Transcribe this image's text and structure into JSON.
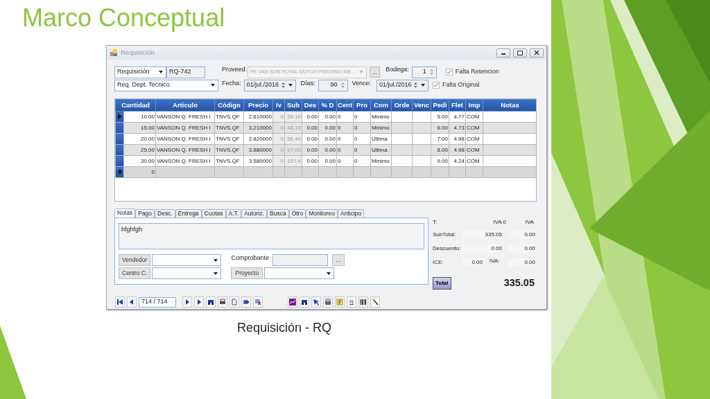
{
  "slide": {
    "title": "Marco Conceptual",
    "caption": "Requisición - RQ"
  },
  "window": {
    "title": "Requisición"
  },
  "header": {
    "doc_type": "Requisición",
    "number": "RQ-742",
    "department": "Req. Dept. Tecnico",
    "supplier_label": "Proveed.",
    "supplier": "PE VAN SON ROYAL DUTCH PRINTING INK ...",
    "supplier_disabled": true,
    "browse_button": "...",
    "warehouse_label": "Bodega:",
    "warehouse": "1",
    "date_label": "Fecha:",
    "date": "01/jul./2016",
    "days_label": "Días:",
    "days": "90",
    "due_label": "Vence:",
    "due": "01/jul./2016",
    "checks": [
      {
        "label": "Falta Retencion",
        "checked": true,
        "disabled": true
      },
      {
        "label": "Falta Original",
        "checked": true,
        "disabled": true
      }
    ]
  },
  "grid": {
    "columns": [
      {
        "label": "Cantidad",
        "muted": false
      },
      {
        "label": "Articulo",
        "muted": false
      },
      {
        "label": "Código",
        "muted": false
      },
      {
        "label": "Precio",
        "muted": false
      },
      {
        "label": "Iv",
        "muted": true
      },
      {
        "label": "Sub",
        "muted": true
      },
      {
        "label": "Des",
        "muted": false
      },
      {
        "label": "% D",
        "muted": false
      },
      {
        "label": "Cent",
        "muted": false
      },
      {
        "label": "Pro",
        "muted": false
      },
      {
        "label": "Com",
        "muted": false
      },
      {
        "label": "Orde",
        "muted": false
      },
      {
        "label": "Venc",
        "muted": false
      },
      {
        "label": "Pedi",
        "muted": false
      },
      {
        "label": "Flet",
        "muted": false
      },
      {
        "label": "Imp",
        "muted": false
      },
      {
        "label": "Notas",
        "muted": false
      }
    ],
    "rows": [
      {
        "kind": "data",
        "current": true,
        "cells": [
          "10.00",
          "VANSON Q. FRESH I",
          "TNVS.QF",
          "2.610000",
          "0",
          "26.10",
          "0.00",
          "0.00",
          "0",
          "0",
          "Minimo",
          "",
          "",
          "5.00",
          "4.77",
          "COM",
          ""
        ]
      },
      {
        "kind": "data",
        "current": false,
        "cells": [
          "15.00",
          "VANSON Q. FRESH I",
          "TNVS.QF",
          "3.210000",
          "0",
          "48.15",
          "0.00",
          "0.00",
          "0",
          "0",
          "Minimo",
          "",
          "",
          "6.00",
          "4.73",
          "COM",
          ""
        ]
      },
      {
        "kind": "data",
        "current": false,
        "cells": [
          "20.00",
          "VANSON Q. FRESH I",
          "TNVS.QF",
          "2.820000",
          "0",
          "56.40",
          "0.00",
          "0.00",
          "0",
          "0",
          "Ultima",
          "",
          "",
          "7.00",
          "4.98",
          "COM",
          ""
        ]
      },
      {
        "kind": "data",
        "current": false,
        "cells": [
          "25.00",
          "VANSON Q. FRESH I",
          "TNVS.QF",
          "3.880000",
          "0",
          "97.00",
          "0.00",
          "0.00",
          "0",
          "0",
          "Ultima",
          "",
          "",
          "8.00",
          "4.98",
          "COM",
          ""
        ]
      },
      {
        "kind": "data",
        "current": false,
        "cells": [
          "30.00",
          "VANSON Q. FRESH I",
          "TNVS.QF",
          "3.580000",
          "0",
          "107.4",
          "0.00",
          "0.00",
          "0",
          "0",
          "Minimo",
          "",
          "",
          "9.00",
          "4.24",
          "COM",
          ""
        ]
      },
      {
        "kind": "new",
        "cells": [
          "0",
          "",
          "",
          "",
          "",
          "",
          "",
          "",
          "",
          "",
          "",
          "",
          "",
          "",
          "",
          "",
          ""
        ]
      }
    ]
  },
  "tabs": [
    {
      "label": "Notas",
      "selected": true
    },
    {
      "label": "Pago",
      "selected": false
    },
    {
      "label": "Desc.",
      "selected": false
    },
    {
      "label": "Entrega",
      "selected": false
    },
    {
      "label": "Cuotas",
      "selected": false
    },
    {
      "label": "A.T.",
      "selected": false
    },
    {
      "label": "Autoriz.",
      "selected": false
    },
    {
      "label": "Busca",
      "selected": false
    },
    {
      "label": "Otro",
      "selected": false
    },
    {
      "label": "Monitoreo",
      "selected": false
    },
    {
      "label": "Anticipo",
      "selected": false
    }
  ],
  "notes": "hfghfgh",
  "form": {
    "seller_button": "Vendedor",
    "cost_center_button": "Centro C.",
    "voucher_label": "Comprobante",
    "voucher_browse": "...",
    "project_button": "Proyecto"
  },
  "totals": {
    "headers": [
      "T:",
      "IVA 0",
      "IVA"
    ],
    "rows": [
      {
        "label": "SubTotal:",
        "values": [
          "335.05",
          "0.00"
        ]
      },
      {
        "label": "Descuento:",
        "values": [
          "0.00",
          "0.00"
        ]
      }
    ],
    "ice_label": "ICE:",
    "ice": "0.00",
    "iva_label": "IVA:",
    "iva": "0.00",
    "total_button": "Total",
    "total": "335.05"
  },
  "navigator": {
    "position": "714 / 714"
  },
  "toolbar": {
    "n_button": "N"
  }
}
